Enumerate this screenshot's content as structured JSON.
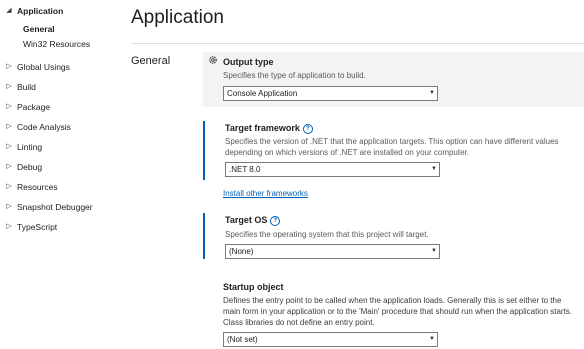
{
  "nav": {
    "application": "Application",
    "sub_general": "General",
    "sub_win32": "Win32 Resources",
    "items": [
      {
        "label": "Global Usings"
      },
      {
        "label": "Build"
      },
      {
        "label": "Package"
      },
      {
        "label": "Code Analysis"
      },
      {
        "label": "Linting"
      },
      {
        "label": "Debug"
      },
      {
        "label": "Resources"
      },
      {
        "label": "Snapshot Debugger"
      },
      {
        "label": "TypeScript"
      }
    ]
  },
  "page": {
    "title": "Application",
    "section": "General"
  },
  "output_type": {
    "title": "Output type",
    "description": "Specifies the type of application to build.",
    "value": "Console Application"
  },
  "target_framework": {
    "title": "Target framework",
    "description": "Specifies the version of .NET that the application targets. This option can have different values depending on which versions of .NET are installed on your computer.",
    "value": ".NET 8.0",
    "link": "Install other frameworks"
  },
  "target_os": {
    "title": "Target OS",
    "description": "Specifies the operating system that this project will target.",
    "value": "(None)"
  },
  "startup_object": {
    "title": "Startup object",
    "description": "Defines the entry point to be called when the application loads. Generally this is set either to the main form in your application or to the 'Main' procedure that should run when the application starts. Class libraries do not define an entry point.",
    "value": "(Not set)"
  },
  "icons": {
    "expanded": "caret-down-icon",
    "collapsed": "caret-right-icon",
    "gear": "gear-icon",
    "help": "help-icon"
  },
  "colors": {
    "accent": "#005fb8",
    "highlight_bg": "#f3f3f3"
  }
}
